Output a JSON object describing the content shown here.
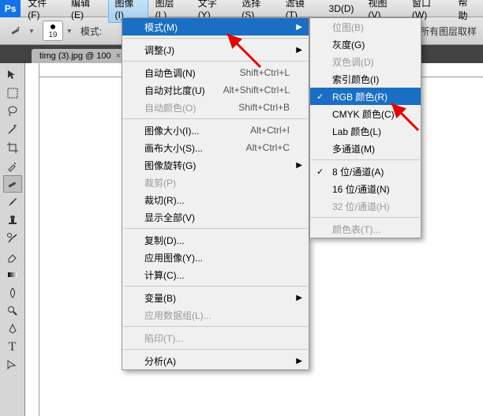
{
  "menubar": {
    "items": [
      "文件(F)",
      "编辑(E)",
      "图像(I)",
      "图层(L)",
      "文字(Y)",
      "选择(S)",
      "滤镜(T)",
      "3D(D)",
      "视图(V)",
      "窗口(W)",
      "帮助"
    ]
  },
  "toolbar": {
    "brush_size": "19",
    "mode_label": "模式:",
    "sample_label": "对所有图层取样"
  },
  "tab": {
    "title": "timg (3).jpg @ 100",
    "close": "×"
  },
  "menu1": {
    "mode": "模式(M)",
    "adjust": "调整(J)",
    "auto_tone": "自动色调(N)",
    "auto_tone_sc": "Shift+Ctrl+L",
    "auto_contrast": "自动对比度(U)",
    "auto_contrast_sc": "Alt+Shift+Ctrl+L",
    "auto_color": "自动颜色(O)",
    "auto_color_sc": "Shift+Ctrl+B",
    "image_size": "图像大小(I)...",
    "image_size_sc": "Alt+Ctrl+I",
    "canvas_size": "画布大小(S)...",
    "canvas_size_sc": "Alt+Ctrl+C",
    "rotate": "图像旋转(G)",
    "crop": "裁剪(P)",
    "trim": "裁切(R)...",
    "reveal": "显示全部(V)",
    "duplicate": "复制(D)...",
    "apply": "应用图像(Y)...",
    "calc": "计算(C)...",
    "variables": "变量(B)",
    "datasets": "应用数据组(L)...",
    "trap": "陷印(T)...",
    "analysis": "分析(A)"
  },
  "menu2": {
    "bitmap": "位图(B)",
    "gray": "灰度(G)",
    "duo": "双色调(D)",
    "indexed": "索引颜色(I)",
    "rgb": "RGB 颜色(R)",
    "cmyk": "CMYK 颜色(C)",
    "lab": "Lab 颜色(L)",
    "multi": "多通道(M)",
    "b8": "8 位/通道(A)",
    "b16": "16 位/通道(N)",
    "b32": "32 位/通道(H)",
    "ctable": "颜色表(T)..."
  }
}
